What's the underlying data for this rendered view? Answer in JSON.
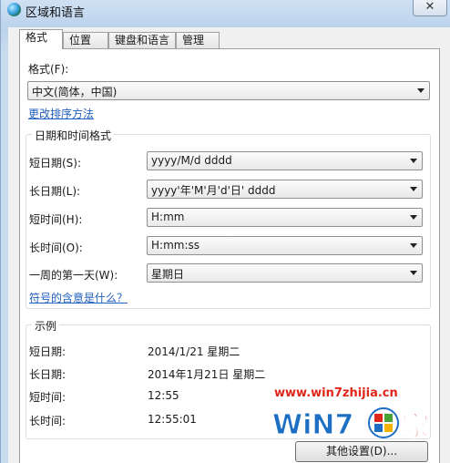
{
  "window": {
    "title": "区域和语言",
    "close_glyph": "✕"
  },
  "tabs": [
    {
      "label": "格式"
    },
    {
      "label": "位置"
    },
    {
      "label": "键盘和语言"
    },
    {
      "label": "管理"
    }
  ],
  "format": {
    "label": "格式(F):",
    "value": "中文(简体，中国)",
    "sort_link": "更改排序方法"
  },
  "datetime_formats": {
    "group_title": "日期和时间格式",
    "rows": [
      {
        "label": "短日期(S):",
        "value": "yyyy/M/d dddd"
      },
      {
        "label": "长日期(L):",
        "value": "yyyy'年'M'月'd'日' dddd"
      },
      {
        "label": "短时间(H):",
        "value": "H:mm"
      },
      {
        "label": "长时间(O):",
        "value": "H:mm:ss"
      },
      {
        "label": "一周的第一天(W):",
        "value": "星期日"
      }
    ],
    "notation_link": "符号的含意是什么？"
  },
  "examples": {
    "group_title": "示例",
    "rows": [
      {
        "label": "短日期:",
        "value": "2014/1/21 星期二"
      },
      {
        "label": "长日期:",
        "value": "2014年1月21日 星期二"
      },
      {
        "label": "短时间:",
        "value": "12:55"
      },
      {
        "label": "长时间:",
        "value": "12:55:01"
      }
    ]
  },
  "buttons": {
    "additional_settings": "其他设置(D)..."
  },
  "watermark": {
    "url": "www.win7zhijia.cn",
    "logo_text": "WiN7",
    "logo_char": "家"
  },
  "colors": {
    "accent_link": "#1f5fbf",
    "watermark_red": "#e0261b",
    "watermark_blue": "#1d6fc4"
  }
}
